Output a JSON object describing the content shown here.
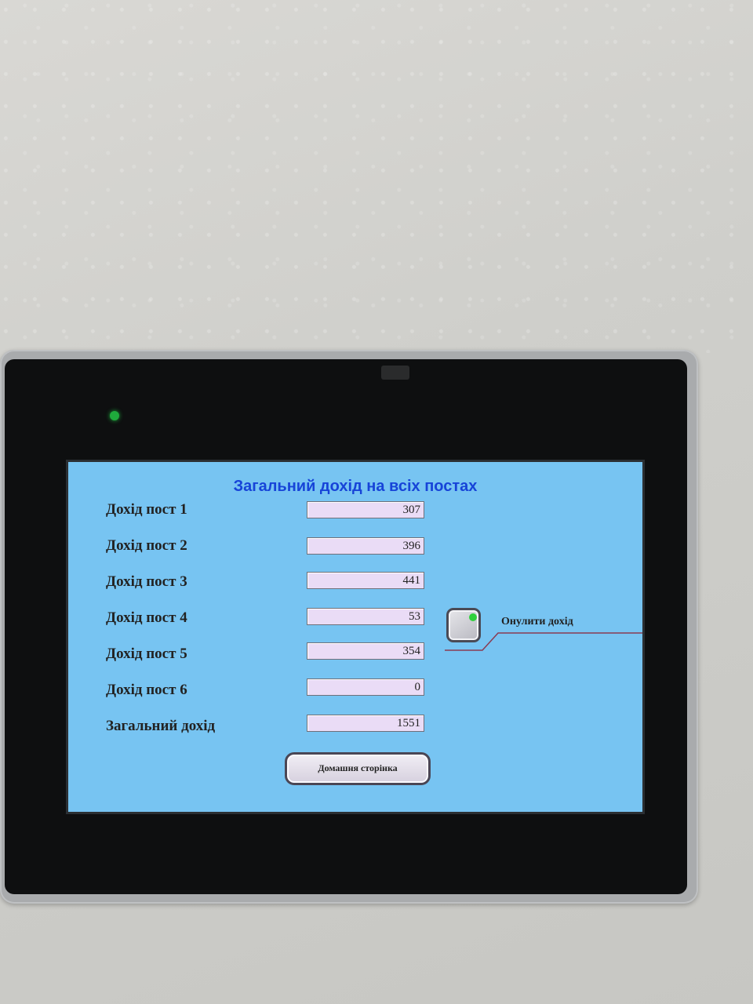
{
  "screen": {
    "title": "Загальний дохід на всіх постах",
    "rows": [
      {
        "label": "Дохід пост 1",
        "value": "307"
      },
      {
        "label": "Дохід пост 2",
        "value": "396"
      },
      {
        "label": "Дохід пост 3",
        "value": "441"
      },
      {
        "label": "Дохід пост 4",
        "value": "53"
      },
      {
        "label": "Дохід пост 5",
        "value": "354"
      },
      {
        "label": "Дохід пост 6",
        "value": "0"
      },
      {
        "label": "Загальний дохід",
        "value": "1551"
      }
    ],
    "reset_label": "Онулити дохід",
    "home_label": "Домашня сторінка"
  },
  "colors": {
    "screen_background": "#77c4f2",
    "title_color": "#1744d8",
    "field_background": "#eadcf6",
    "indicator_green": "#2fd13c",
    "power_led": "#1faa3c"
  }
}
